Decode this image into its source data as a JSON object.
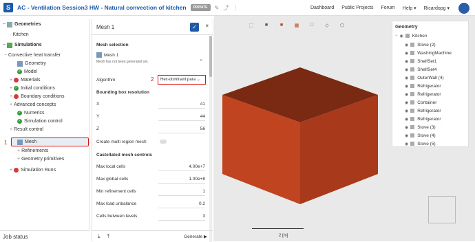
{
  "app": {
    "title": "AC - Ventilation Session3 HW - Natural convection of kitchen",
    "badge": "PRIVATE",
    "nav": [
      "Dashboard",
      "Public Projects",
      "Forum",
      "Help ▾"
    ],
    "user": "Ricardopg ▾"
  },
  "tree": {
    "geometries": "Geometries",
    "kitchen": "Kitchen",
    "simulations": "Simulations",
    "sim": "Convective heat transfer",
    "geometry": "Geometry",
    "model": "Model",
    "materials": "Materials",
    "initial": "Initial conditions",
    "boundary": "Boundary conditions",
    "advanced": "Advanced concepts",
    "numerics": "Numerics",
    "simcontrol": "Simulation control",
    "result": "Result control",
    "mesh": "Mesh",
    "refinements": "Refinements",
    "geomprim": "Geometry primitives",
    "runs": "Simulation Runs",
    "mesh_num": "1"
  },
  "job": "Job status",
  "panel": {
    "title": "Mesh 1",
    "sel_head": "Mesh selection",
    "mesh_name": "Mesh 1",
    "mesh_sub": "Mesh has not been generated yet.",
    "algo_label": "Algorithm",
    "algo_value": "Hex-dominant para",
    "algo_num": "2",
    "bbox": "Bounding box resolution",
    "x_l": "X",
    "x_v": "41",
    "y_l": "Y",
    "y_v": "44",
    "z_l": "Z",
    "z_v": "56",
    "multi": "Create multi region mesh",
    "cast": "Castellated mesh controls",
    "mlc_l": "Max local cells",
    "mlc_v": "4.00e+7",
    "mgc_l": "Max global cells",
    "mgc_v": "1.00e+8",
    "mrc_l": "Min refinement cells",
    "mrc_v": "1",
    "mlu_l": "Max load unbalance",
    "mlu_v": "0.2",
    "cbl_l": "Cells between levels",
    "cbl_v": "3",
    "generate": "Generate ▶"
  },
  "geo": {
    "head": "Geometry",
    "root": "Kitchen",
    "items": [
      "Stove (2)",
      "WashingMachine",
      "ShelfSet1",
      "ShelfSet4",
      "OuterWall (4)",
      "Refrigerator",
      "Refrigerator",
      "Container",
      "Refrigerator",
      "Refrigerator",
      "Stove (3)",
      "Stove (4)",
      "Stove (5)"
    ]
  },
  "scale": "2 [m]",
  "colors": {
    "accent": "#1e5aa8",
    "box_front": "#c0441f",
    "box_top": "#7a2a12",
    "box_side": "#a8391a",
    "highlight": "#dd1111"
  }
}
